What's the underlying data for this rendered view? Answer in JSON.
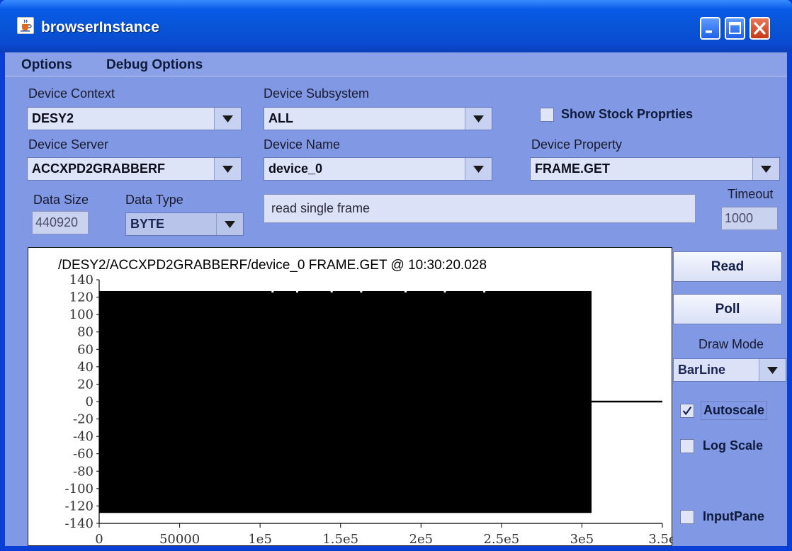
{
  "window": {
    "title": "browserInstance",
    "icon": "java-cup-icon",
    "controls": [
      "minimize-icon",
      "maximize-icon",
      "close-icon"
    ]
  },
  "menu": {
    "items": [
      "Options",
      "Debug Options"
    ]
  },
  "form": {
    "device_context": {
      "label": "Device Context",
      "value": "DESY2"
    },
    "device_subsystem": {
      "label": "Device Subsystem",
      "value": "ALL"
    },
    "show_stock": {
      "label": "Show Stock Proprties",
      "checked": false
    },
    "device_server": {
      "label": "Device Server",
      "value": "ACCXPD2GRABBERF"
    },
    "device_name": {
      "label": "Device Name",
      "value": "device_0"
    },
    "device_property": {
      "label": "Device Property",
      "value": "FRAME.GET"
    },
    "data_size": {
      "label": "Data Size",
      "value": "440920"
    },
    "data_type": {
      "label": "Data Type",
      "value": "BYTE"
    },
    "description": "read single frame",
    "timeout": {
      "label": "Timeout",
      "value": "1000"
    }
  },
  "controls": {
    "read_label": "Read",
    "poll_label": "Poll",
    "draw_mode_label": "Draw Mode",
    "draw_mode_value": "BarLine",
    "autoscale": {
      "label": "Autoscale",
      "checked": true
    },
    "log_scale": {
      "label": "Log Scale",
      "checked": false
    },
    "input_pane": {
      "label": "InputPane",
      "checked": false
    }
  },
  "chart_data": {
    "type": "bar",
    "title": "/DESY2/ACCXPD2GRABBERF/device_0 FRAME.GET @ 10:30:20.028",
    "xlim": [
      0,
      350000
    ],
    "ylim": [
      -140,
      140
    ],
    "x_ticks": [
      "0",
      "50000",
      "1e5",
      "1.5e5",
      "2e5",
      "2.5e5",
      "3e5",
      "3.5e"
    ],
    "y_ticks": [
      "140",
      "120",
      "100",
      "80",
      "60",
      "40",
      "20",
      "0",
      "-20",
      "-40",
      "-60",
      "-80",
      "-100",
      "-120",
      "-140"
    ],
    "data_extent_x": [
      0,
      306000
    ],
    "value_range": [
      -128,
      127
    ],
    "after_extent_value": 0
  }
}
